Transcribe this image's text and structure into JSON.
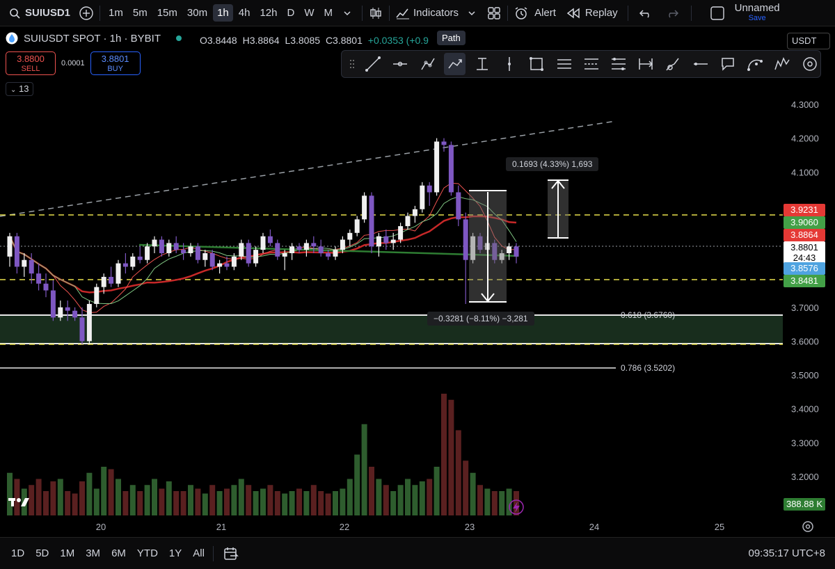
{
  "topbar": {
    "symbol": "SUIUSD1",
    "timeframes": [
      "1m",
      "5m",
      "15m",
      "30m",
      "1h",
      "4h",
      "12h",
      "D",
      "W",
      "M"
    ],
    "active_timeframe": "1h",
    "indicators_label": "Indicators",
    "alert_label": "Alert",
    "replay_label": "Replay",
    "layout_name": "Unnamed",
    "save_label": "Save"
  },
  "legend": {
    "title": "SUIUSDT SPOT · 1h · BYBIT",
    "o": "O3.8448",
    "h": "H3.8864",
    "l": "L3.8085",
    "c": "C3.8801",
    "change": "+0.0353 (+0.9"
  },
  "trade": {
    "sell_price": "3.8800",
    "sell_label": "SELL",
    "spread": "0.0001",
    "buy_price": "3.8801",
    "buy_label": "BUY"
  },
  "indicator_count": "13",
  "tooltip": "Path",
  "currency": "USDT",
  "price_axis": {
    "ticks": [
      "4.3000",
      "4.2000",
      "4.1000",
      "3.7000",
      "3.6000",
      "3.5000",
      "3.4000",
      "3.3000",
      "3.2000"
    ],
    "labels": [
      {
        "text": "3.9231",
        "color": "#e53935"
      },
      {
        "text": "3.9060",
        "color": "#43a047"
      },
      {
        "text": "3.8864",
        "color": "#e53935"
      },
      {
        "text": "3.8801",
        "color": "#ffffff"
      },
      {
        "text": "24:43",
        "color": "#ffffff"
      },
      {
        "text": "3.8576",
        "color": "#4fa3e0"
      },
      {
        "text": "3.8481",
        "color": "#43a047"
      },
      {
        "text": "388.88 K",
        "color": "#2e7d32"
      }
    ]
  },
  "time_axis": [
    "20",
    "21",
    "22",
    "23",
    "24",
    "25"
  ],
  "measures": {
    "up": "0.1693 (4.33%) 1,693",
    "down": "−0.3281 (−8.11%) −3,281"
  },
  "fib": {
    "f618": "0.618 (3.6760)",
    "f786": "0.786 (3.5202)"
  },
  "bottombar": {
    "ranges": [
      "1D",
      "5D",
      "1M",
      "3M",
      "6M",
      "YTD",
      "1Y",
      "All"
    ],
    "clock": "09:35:17 UTC+8"
  },
  "chart_data": {
    "type": "candlestick",
    "ylim": [
      3.1,
      4.35
    ],
    "candles": [
      [
        3.85,
        3.92,
        3.82,
        3.91
      ],
      [
        3.91,
        3.92,
        3.8,
        3.82
      ],
      [
        3.82,
        3.86,
        3.79,
        3.84
      ],
      [
        3.84,
        3.86,
        3.77,
        3.8
      ],
      [
        3.8,
        3.83,
        3.75,
        3.77
      ],
      [
        3.77,
        3.8,
        3.73,
        3.75
      ],
      [
        3.75,
        3.78,
        3.66,
        3.67
      ],
      [
        3.67,
        3.72,
        3.66,
        3.7
      ],
      [
        3.7,
        3.72,
        3.66,
        3.69
      ],
      [
        3.69,
        3.7,
        3.66,
        3.67
      ],
      [
        3.67,
        3.7,
        3.59,
        3.6
      ],
      [
        3.6,
        3.72,
        3.59,
        3.71
      ],
      [
        3.71,
        3.77,
        3.7,
        3.76
      ],
      [
        3.76,
        3.8,
        3.74,
        3.79
      ],
      [
        3.79,
        3.82,
        3.76,
        3.77
      ],
      [
        3.77,
        3.84,
        3.76,
        3.83
      ],
      [
        3.83,
        3.86,
        3.8,
        3.82
      ],
      [
        3.82,
        3.86,
        3.81,
        3.85
      ],
      [
        3.85,
        3.88,
        3.83,
        3.84
      ],
      [
        3.84,
        3.89,
        3.83,
        3.88
      ],
      [
        3.88,
        3.91,
        3.86,
        3.9
      ],
      [
        3.9,
        3.91,
        3.85,
        3.86
      ],
      [
        3.86,
        3.9,
        3.85,
        3.89
      ],
      [
        3.89,
        3.91,
        3.86,
        3.87
      ],
      [
        3.87,
        3.89,
        3.84,
        3.86
      ],
      [
        3.86,
        3.89,
        3.85,
        3.88
      ],
      [
        3.88,
        3.89,
        3.83,
        3.84
      ],
      [
        3.84,
        3.87,
        3.82,
        3.86
      ],
      [
        3.86,
        3.87,
        3.81,
        3.82
      ],
      [
        3.82,
        3.84,
        3.8,
        3.83
      ],
      [
        3.83,
        3.85,
        3.81,
        3.82
      ],
      [
        3.82,
        3.86,
        3.81,
        3.85
      ],
      [
        3.85,
        3.9,
        3.84,
        3.89
      ],
      [
        3.89,
        3.9,
        3.82,
        3.83
      ],
      [
        3.83,
        3.88,
        3.82,
        3.87
      ],
      [
        3.87,
        3.92,
        3.86,
        3.91
      ],
      [
        3.91,
        3.93,
        3.88,
        3.89
      ],
      [
        3.89,
        3.9,
        3.84,
        3.85
      ],
      [
        3.85,
        3.87,
        3.81,
        3.86
      ],
      [
        3.86,
        3.89,
        3.84,
        3.88
      ],
      [
        3.88,
        3.89,
        3.86,
        3.87
      ],
      [
        3.87,
        3.9,
        3.85,
        3.89
      ],
      [
        3.89,
        3.91,
        3.86,
        3.88
      ],
      [
        3.88,
        3.9,
        3.85,
        3.86
      ],
      [
        3.86,
        3.87,
        3.84,
        3.85
      ],
      [
        3.85,
        3.88,
        3.84,
        3.87
      ],
      [
        3.87,
        3.91,
        3.86,
        3.9
      ],
      [
        3.9,
        3.93,
        3.88,
        3.92
      ],
      [
        3.92,
        3.97,
        3.91,
        3.96
      ],
      [
        3.96,
        4.04,
        3.95,
        4.03
      ],
      [
        4.03,
        4.04,
        3.86,
        3.88
      ],
      [
        3.88,
        3.92,
        3.85,
        3.91
      ],
      [
        3.91,
        3.93,
        3.87,
        3.89
      ],
      [
        3.89,
        3.92,
        3.87,
        3.9
      ],
      [
        3.9,
        3.95,
        3.89,
        3.94
      ],
      [
        3.94,
        3.98,
        3.93,
        3.97
      ],
      [
        3.97,
        4.0,
        3.95,
        3.99
      ],
      [
        3.99,
        4.07,
        3.98,
        4.06
      ],
      [
        4.06,
        4.07,
        4.0,
        4.04
      ],
      [
        4.04,
        4.2,
        4.03,
        4.19
      ],
      [
        4.19,
        4.2,
        4.16,
        4.18
      ],
      [
        4.18,
        4.19,
        4.03,
        4.04
      ],
      [
        4.04,
        4.06,
        3.94,
        3.96
      ],
      [
        3.96,
        3.98,
        3.71,
        3.84
      ],
      [
        3.84,
        3.92,
        3.83,
        3.91
      ],
      [
        3.91,
        3.92,
        3.86,
        3.87
      ],
      [
        3.87,
        3.91,
        3.86,
        3.89
      ],
      [
        3.89,
        3.9,
        3.83,
        3.84
      ],
      [
        3.84,
        3.87,
        3.83,
        3.86
      ],
      [
        3.86,
        3.89,
        3.84,
        3.88
      ],
      [
        3.88,
        3.89,
        3.83,
        3.85
      ]
    ],
    "volumes": [
      0.35,
      0.3,
      0.22,
      0.25,
      0.3,
      0.2,
      0.28,
      0.3,
      0.2,
      0.18,
      0.28,
      0.35,
      0.22,
      0.4,
      0.38,
      0.3,
      0.2,
      0.25,
      0.2,
      0.25,
      0.3,
      0.22,
      0.28,
      0.2,
      0.2,
      0.25,
      0.22,
      0.18,
      0.25,
      0.2,
      0.22,
      0.25,
      0.3,
      0.25,
      0.2,
      0.22,
      0.25,
      0.2,
      0.18,
      0.2,
      0.22,
      0.2,
      0.25,
      0.2,
      0.18,
      0.2,
      0.22,
      0.3,
      0.5,
      0.75,
      0.4,
      0.3,
      0.25,
      0.2,
      0.25,
      0.3,
      0.25,
      0.28,
      0.3,
      0.4,
      1.0,
      0.95,
      0.7,
      0.45,
      0.35,
      0.25,
      0.22,
      0.2,
      0.2,
      0.22,
      0.2
    ]
  }
}
